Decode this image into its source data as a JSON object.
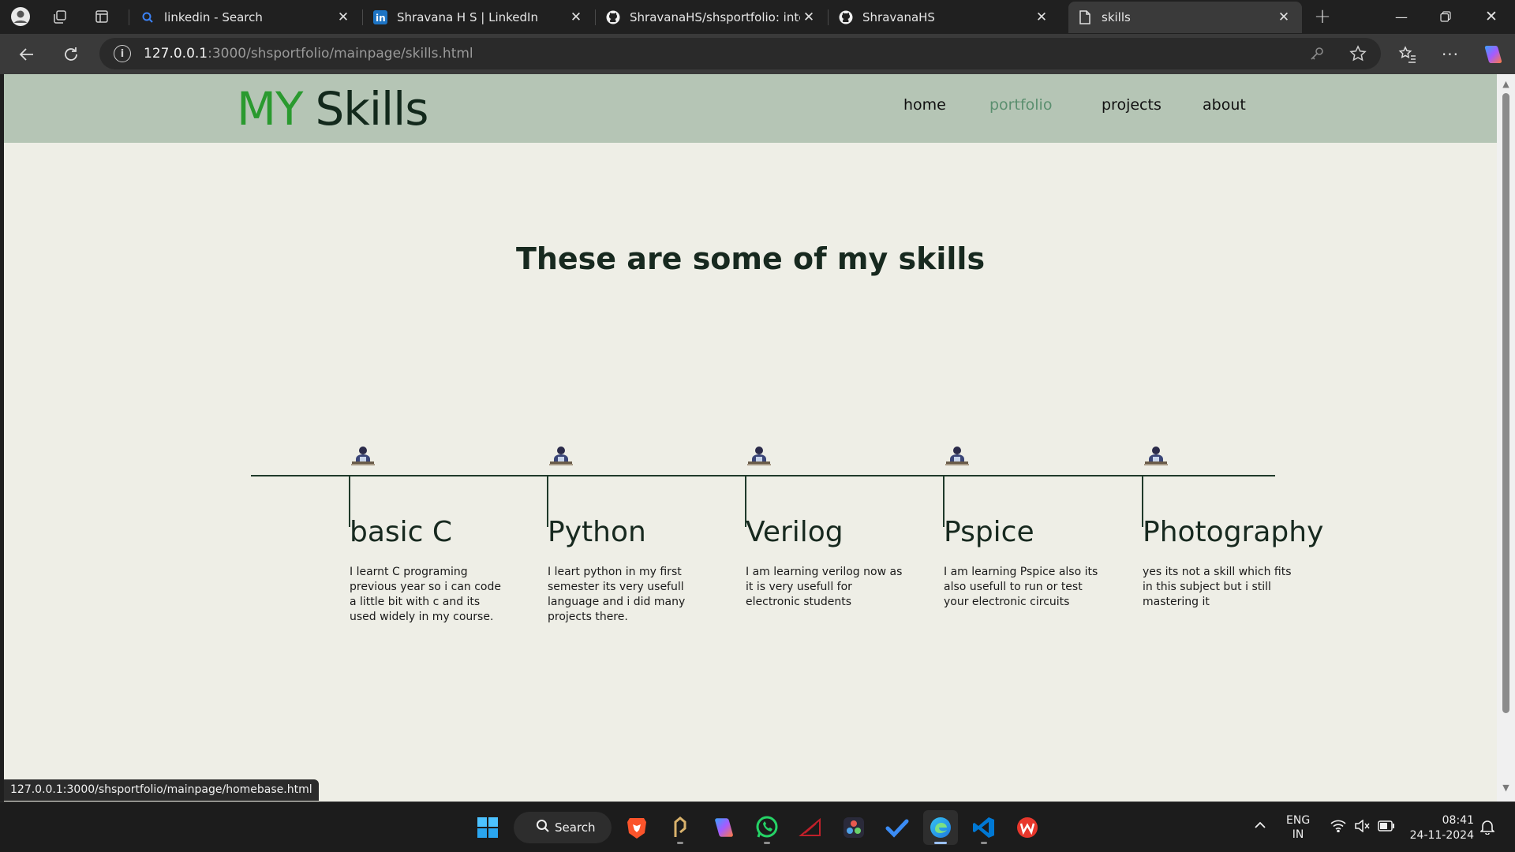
{
  "browser": {
    "tabs": [
      {
        "title": "linkedin - Search",
        "icon": "search-icon"
      },
      {
        "title": "Shravana H S | LinkedIn",
        "icon": "linkedin-icon"
      },
      {
        "title": "ShravanaHS/shsportfolio: internsl",
        "icon": "github-icon"
      },
      {
        "title": "ShravanaHS",
        "icon": "github-icon"
      },
      {
        "title": "skills",
        "icon": "page-icon"
      }
    ],
    "address": {
      "host": "127.0.0.1",
      "path": ":3000/shsportfolio/mainpage/skills.html"
    }
  },
  "page": {
    "logo": {
      "my": "MY",
      "rest": "Skills"
    },
    "nav": {
      "home": "home",
      "portfolio": "portfolio",
      "projects": "projects",
      "about": "about"
    },
    "heading": "These are some of my skills",
    "skills": [
      {
        "name": "basic C",
        "desc": "I learnt C programing previous year so i can code a little bit with c and its used widely in my course."
      },
      {
        "name": "Python",
        "desc": "I leart python in my first semester its very usefull language and i did many projects there."
      },
      {
        "name": "Verilog",
        "desc": "I am learning verilog now as it is very usefull for electronic students"
      },
      {
        "name": "Pspice",
        "desc": "I am learning Pspice also its also usefull to run or test your electronic circuits"
      },
      {
        "name": "Photography",
        "desc": "yes its not a skill which fits in this subject but i still mastering it"
      }
    ],
    "status_url": "127.0.0.1:3000/shsportfolio/mainpage/homebase.html"
  },
  "taskbar": {
    "search_label": "Search",
    "lang": {
      "line1": "ENG",
      "line2": "IN"
    },
    "time": "08:41",
    "date": "24-11-2024"
  },
  "colors": {
    "accent_green": "#2a9a2f",
    "header_bg": "#b5c5b5",
    "page_bg": "#eeeee6",
    "dark_green": "#17291f",
    "nav_active": "#5b8f6f"
  }
}
